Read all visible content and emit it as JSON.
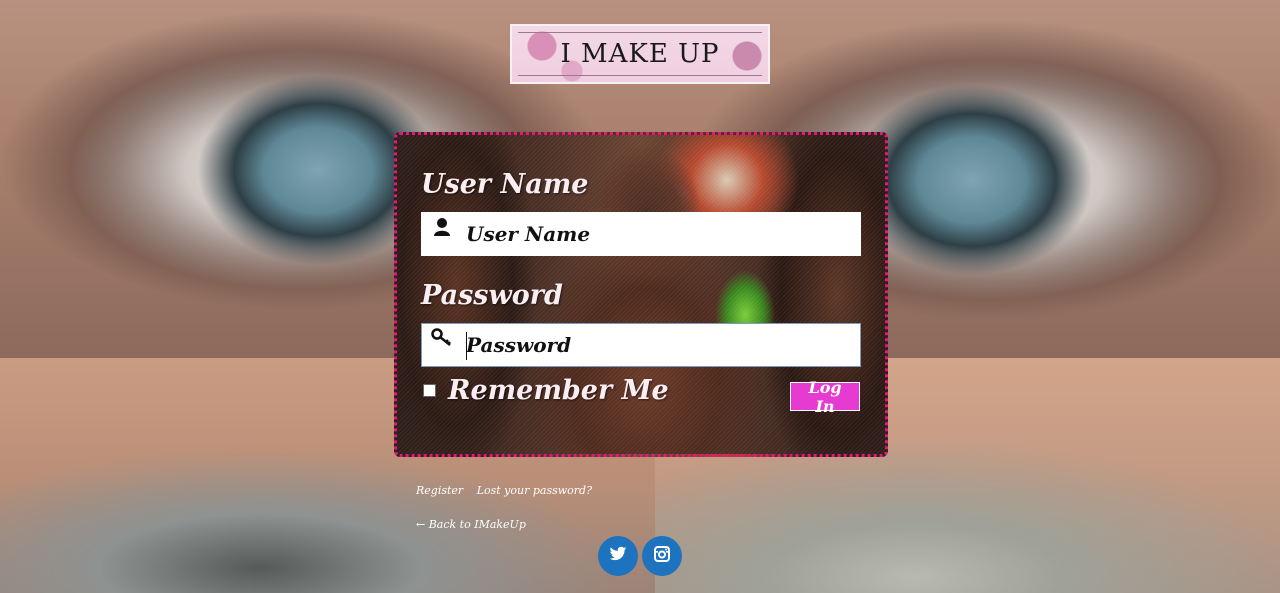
{
  "logo": {
    "text": "I MAKE UP"
  },
  "login": {
    "username_label": "User Name",
    "username_placeholder": "User Name",
    "password_label": "Password",
    "password_placeholder": "Password",
    "remember_label": "Remember Me",
    "remember_checked": false,
    "submit_label": "Log In"
  },
  "links": {
    "register": "Register",
    "lost_password": "Lost your password?",
    "back": "← Back to IMakeUp"
  },
  "social": [
    {
      "name": "twitter-icon"
    },
    {
      "name": "instagram-icon"
    }
  ],
  "colors": {
    "panel_border": "#e8157b",
    "login_button": "#e63bd0",
    "social_circle": "#1e73be"
  }
}
